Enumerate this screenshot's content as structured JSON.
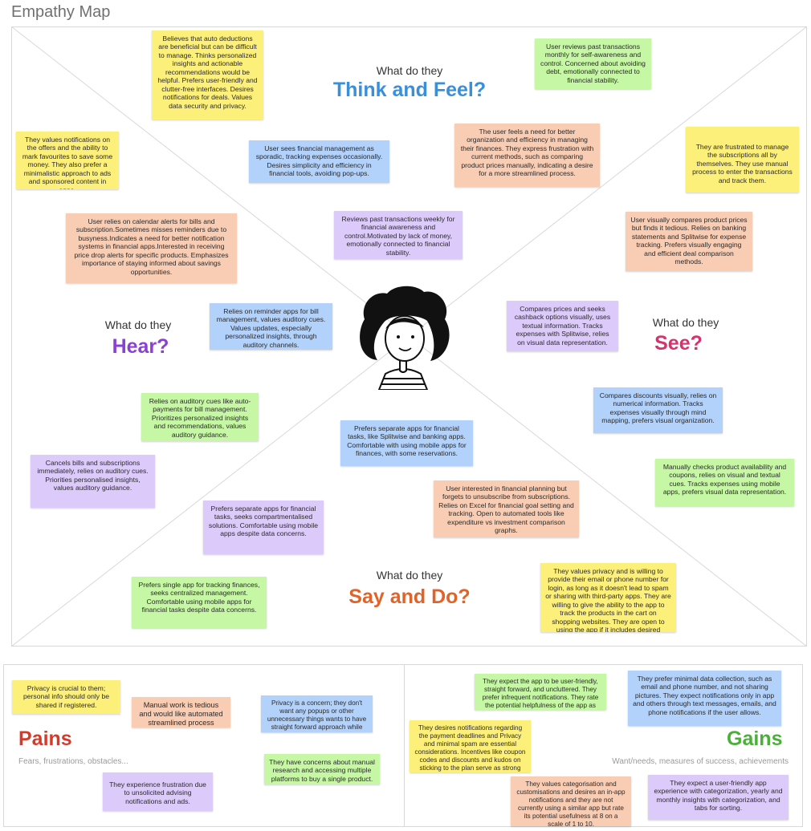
{
  "title": "Empathy Map",
  "colors": {
    "think": "#3a8fdb",
    "hear": "#8b3fd6",
    "see": "#d6336c",
    "say": "#e0632a",
    "pains": "#d63a2a",
    "gains": "#4caf3a",
    "yellow": "#fdf07a",
    "green": "#c6f7a4",
    "orange": "#f8cdb4",
    "blue": "#b2d1fb",
    "purple": "#dccafb"
  },
  "sections": {
    "think": {
      "pre": "What do they",
      "main": "Think and Feel?"
    },
    "hear": {
      "pre": "What do they",
      "main": "Hear?"
    },
    "see": {
      "pre": "What do they",
      "main": "See?"
    },
    "say": {
      "pre": "What do they",
      "main": "Say and Do?"
    }
  },
  "avatar_icon": "person-with-curly-hair-icon",
  "notes": {
    "n1": "Believes that auto deductions are beneficial but can be difficult to manage. Thinks personalized insights and actionable recommendations would be helpful. Prefers user-friendly and clutter-free interfaces. Desires notifications for deals. Values data security and privacy.",
    "n2": "User reviews past transactions monthly for self-awareness and control. Concerned about avoiding debt, emotionally connected to financial stability.",
    "n3": "They values  notifications on the offers and the ability to mark favourites to save some money. They also prefer a minimalistic approach to ads and sponsored content in apps.",
    "n4": "User sees financial management as sporadic, tracking expenses occasionally. Desires simplicity and efficiency in financial tools, avoiding pop-ups.",
    "n5": "The user feels a need for better organization and efficiency in managing their finances. They express frustration with current methods, such as comparing product prices manually, indicating a desire for a more streamlined process.",
    "n6": "They are frustrated to manage the subscriptions all by themselves. They use manual process to enter the transactions and track them.",
    "n7": "User relies on calendar alerts for bills and subscription.Sometimes misses reminders due to busyness.Indicates a need for better notification systems in financial apps.Interested in receiving price drop alerts for specific products. Emphasizes importance of staying informed about savings opportunities.",
    "n8": "Reviews past transactions weekly for financial awareness and control.Motivated by lack of money, emotionally connected to financial stability.",
    "n9": "User visually compares product prices but finds it tedious. Relies on banking statements and Splitwise for expense tracking. Prefers visually engaging and efficient deal comparison methods.",
    "n10": "Relies on reminder apps for bill management, values auditory cues. Values updates, especially personalized insights, through auditory channels.",
    "n11": "Compares prices and seeks cashback options visually, uses textual information. Tracks expenses with Splitwise, relies on visual data representation.",
    "n12": "Relies on auditory cues like auto-payments for bill management. Prioritizes personalized insights and recommendations, values auditory guidance.",
    "n13": "Compares discounts visually, relies on numerical information. Tracks expenses visually through mind mapping, prefers visual organization.",
    "n14": "Prefers separate apps for financial tasks, like Splitwise and banking apps. Comfortable with using mobile apps for finances, with some reservations.",
    "n15": "Cancels bills and subscriptions immediately, relies on auditory cues. Priorities personalised insights, values auditory guidance.",
    "n16": "Manually checks product availability and coupons, relies on visual and textual cues. Tracks expenses using mobile apps, prefers visual data representation.",
    "n17": "User interested in financial planning but forgets to unsubscribe from subscriptions. Relies on Excel for financial goal setting and tracking. Open to automated tools like expenditure vs investment comparison graphs.",
    "n18": "Prefers separate apps for financial tasks, seeks compartmentalised solutions. Comfortable using mobile apps despite data concerns.",
    "n19": "They values privacy and is willing to provide their email or phone number for login, as long as it doesn't lead to spam or sharing with third-party apps. They are willing to give the ability to the app to track the products in the cart on shopping websites. They are open to using the app if it includes desired features, despite not having used a similar app before.",
    "n20": "Prefers single app for tracking finances, seeks centralized management. Comfortable using mobile apps for financial tasks despite data concerns."
  },
  "pains": {
    "title": "Pains",
    "subtitle": "Fears, frustrations, obstacles...",
    "notes": {
      "p1": "Privacy is crucial to them; personal info should only be shared if registered.",
      "p2": "Manual work is tedious and would like automated streamlined process",
      "p3": "Privacy is a concern; they don't want any popups or other unnecessary things wants to have straight forward approach while accessing the app.",
      "p4": "They have concerns about manual research and accessing multiple platforms to buy a single product.",
      "p5": "They experience frustration due to unsolicited advising notifications and ads."
    }
  },
  "gains": {
    "title": "Gains",
    "subtitle": "Want/needs, measures of success, achievements",
    "notes": {
      "g1": "They expect the app to be user-friendly, straight forward, and uncluttered. They prefer infrequent notifications. They rate the potential helpfulness of the app as high.",
      "g2": "They prefer minimal data collection, such as email and phone number, and not sharing pictures. They expect notifications only in app  and others through text messages, emails, and phone notifications if the user allows.",
      "g3": "They desires notifications regarding the payment deadlines and Privacy and minimal spam are essential considerations. Incentives like coupon codes and discounts and kudos on sticking to the plan serve as strong motivators",
      "g4": "They values categorisation and customisations and desires an in-app notifications and they are not currently using a similar app but rate its potential usefulness at 8 on a scale of 1 to 10.",
      "g5": "They expect a user-friendly app experience with categorization, yearly and monthly insights with categorization, and tabs for sorting."
    }
  }
}
